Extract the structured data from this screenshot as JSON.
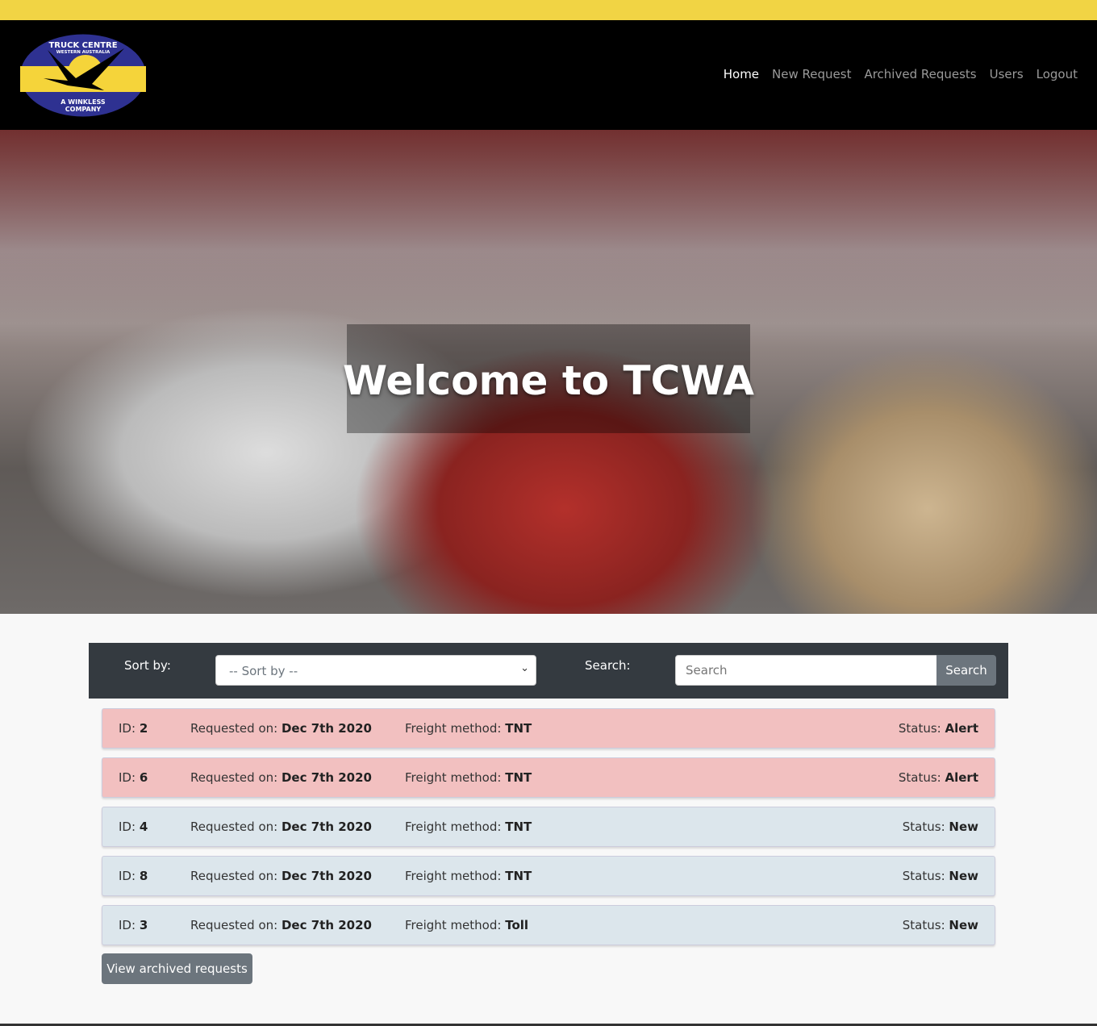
{
  "brand": {
    "logo_text_top": "TRUCK CENTRE",
    "logo_text_sub": "WESTERN AUSTRALIA",
    "logo_text_bottom": "A WINKLESS COMPANY",
    "accent": "#f1d444",
    "logo_blue": "#2e3191"
  },
  "nav": {
    "items": [
      {
        "label": "Home",
        "active": true
      },
      {
        "label": "New Request"
      },
      {
        "label": "Archived Requests"
      },
      {
        "label": "Users"
      },
      {
        "label": "Logout"
      }
    ]
  },
  "hero": {
    "title": "Welcome to TCWA"
  },
  "toolbar": {
    "sort_label": "Sort by:",
    "sort_value": "-- Sort by --",
    "search_label": "Search:",
    "search_placeholder": "Search",
    "search_button": "Search"
  },
  "requests": [
    {
      "id_label": "ID:",
      "id": "2",
      "requested_label": "Requested on:",
      "date": "Dec 7th 2020",
      "freight_label": "Freight method:",
      "freight": "TNT",
      "status_label": "Status:",
      "status": "Alert"
    },
    {
      "id_label": "ID:",
      "id": "6",
      "requested_label": "Requested on:",
      "date": "Dec 7th 2020",
      "freight_label": "Freight method:",
      "freight": "TNT",
      "status_label": "Status:",
      "status": "Alert"
    },
    {
      "id_label": "ID:",
      "id": "4",
      "requested_label": "Requested on:",
      "date": "Dec 7th 2020",
      "freight_label": "Freight method:",
      "freight": "TNT",
      "status_label": "Status:",
      "status": "New"
    },
    {
      "id_label": "ID:",
      "id": "8",
      "requested_label": "Requested on:",
      "date": "Dec 7th 2020",
      "freight_label": "Freight method:",
      "freight": "TNT",
      "status_label": "Status:",
      "status": "New"
    },
    {
      "id_label": "ID:",
      "id": "3",
      "requested_label": "Requested on:",
      "date": "Dec 7th 2020",
      "freight_label": "Freight method:",
      "freight": "Toll",
      "status_label": "Status:",
      "status": "New"
    }
  ],
  "status_colors": {
    "Alert": "#f2c0c0",
    "New": "#dce6ec"
  },
  "archive_button": "View archived requests"
}
